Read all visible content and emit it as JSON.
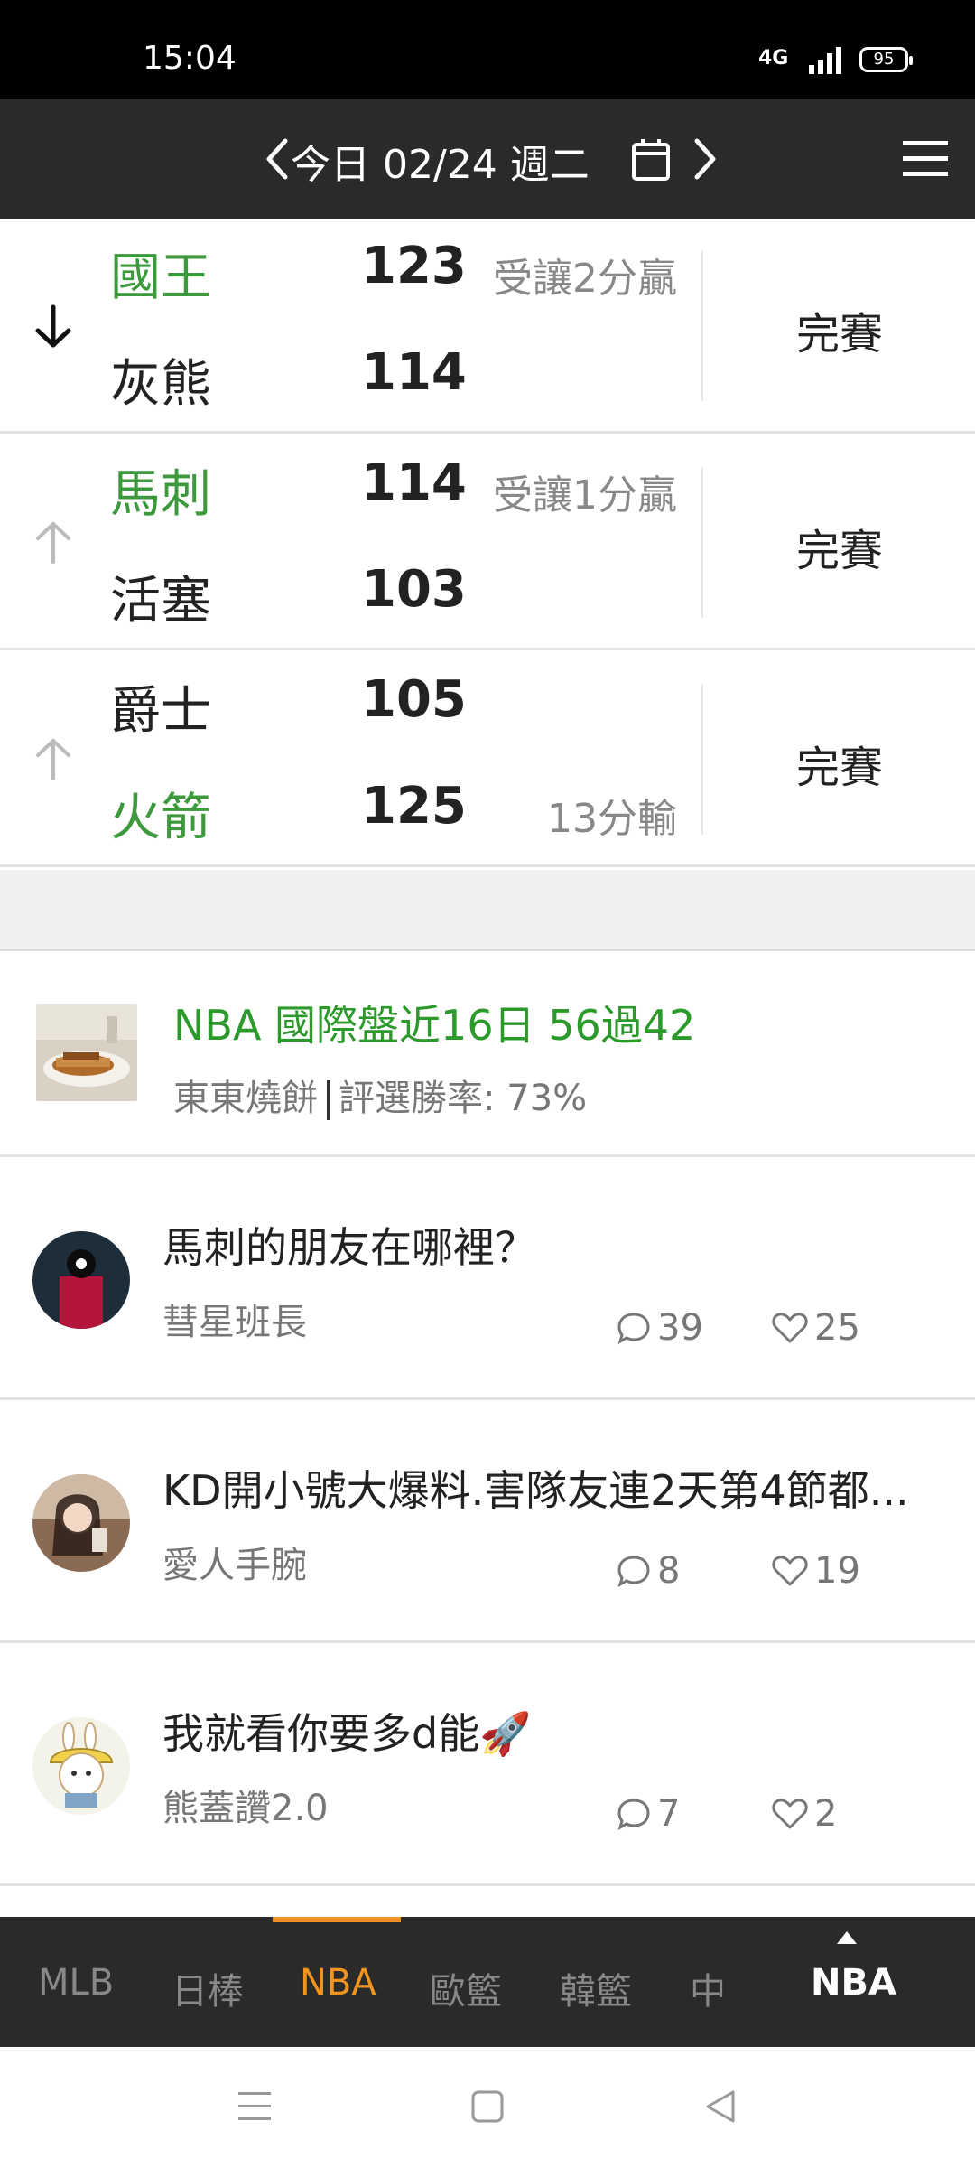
{
  "status_bar": {
    "time": "15:04",
    "network": "4G",
    "battery": "95"
  },
  "top_nav": {
    "date_label": "今日 02/24 週二"
  },
  "games": [
    {
      "sort_arrow": "down",
      "team_top": "國王",
      "score_top": "123",
      "team_bottom": "灰熊",
      "score_bottom": "114",
      "winner": "top",
      "note": "受讓2分贏",
      "note_row": "top",
      "status": "完賽"
    },
    {
      "sort_arrow": "up",
      "team_top": "馬刺",
      "score_top": "114",
      "team_bottom": "活塞",
      "score_bottom": "103",
      "winner": "top",
      "note": "受讓1分贏",
      "note_row": "top",
      "status": "完賽"
    },
    {
      "sort_arrow": "up",
      "team_top": "爵士",
      "score_top": "105",
      "team_bottom": "火箭",
      "score_bottom": "125",
      "winner": "bottom",
      "note": "13分輸",
      "note_row": "bottom",
      "status": "完賽"
    }
  ],
  "promo": {
    "title": "NBA 國際盤近16日 56過42",
    "author": "東東燒餅",
    "win_rate": "評選勝率: 73%"
  },
  "posts": [
    {
      "title": "馬刺的朋友在哪裡？",
      "author": "彗星班長",
      "comments": "39",
      "likes": "25"
    },
    {
      "title": "KD開小號大爆料.害隊友連2天第4節都...",
      "author": "愛人手腕",
      "comments": "8",
      "likes": "19"
    },
    {
      "title": "我就看你要多d能🚀",
      "author": "熊蓋讚2.0",
      "comments": "7",
      "likes": "2"
    }
  ],
  "tabs": [
    {
      "label": "MLB",
      "active": false
    },
    {
      "label": "日棒",
      "active": false
    },
    {
      "label": "NBA",
      "active": true
    },
    {
      "label": "歐籃",
      "active": false
    },
    {
      "label": "韓籃",
      "active": false
    },
    {
      "label": "中",
      "active": false
    }
  ],
  "sport_selector": "NBA",
  "colors": {
    "win_green": "#3c9a3c",
    "accent_orange": "#f0941d",
    "header_dark": "#2a2a2a"
  }
}
